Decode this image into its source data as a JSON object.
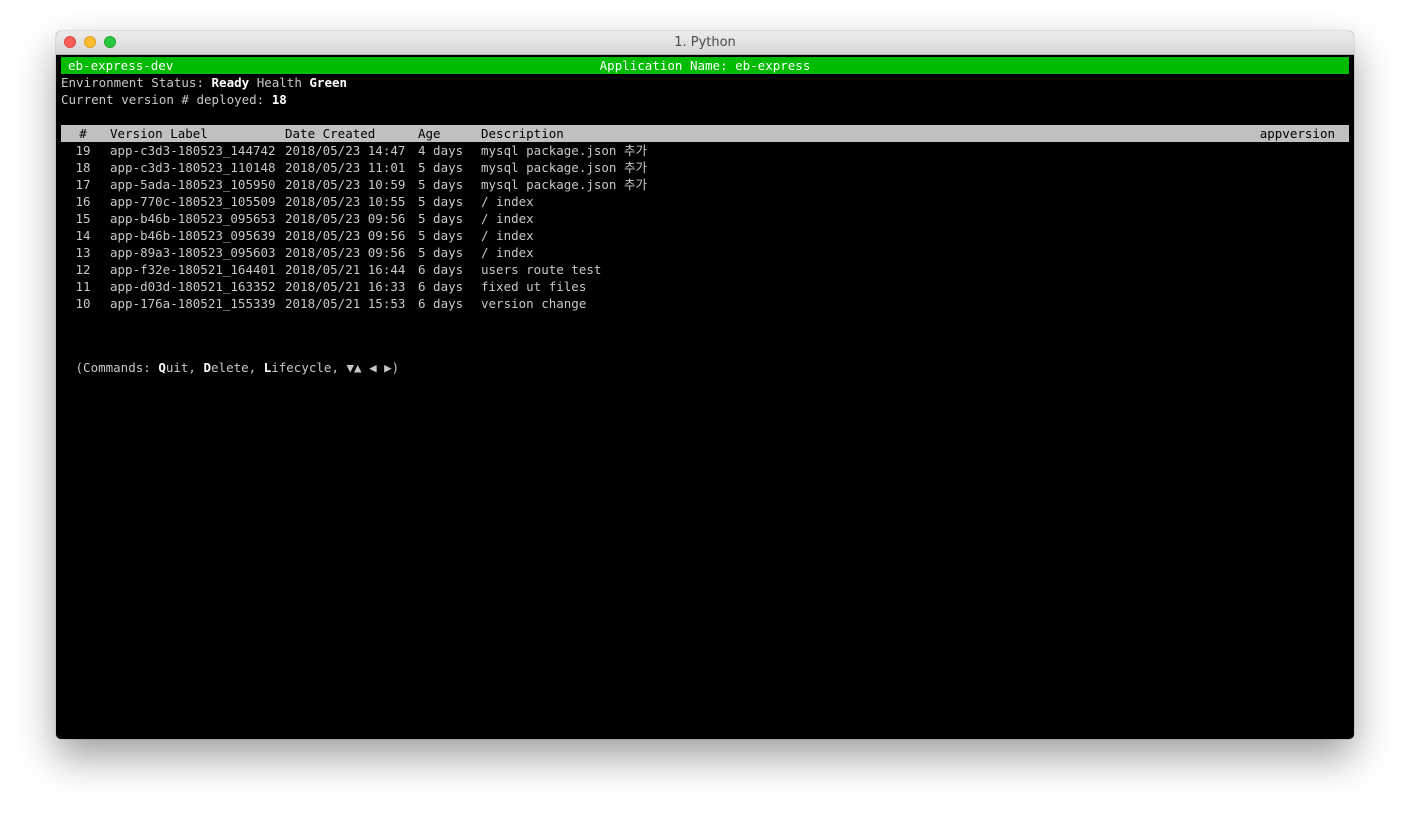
{
  "window": {
    "title": "1. Python"
  },
  "status_bar": {
    "environment": "eb-express-dev",
    "application": "Application Name: eb-express"
  },
  "info": {
    "env_status_label": "Environment Status:",
    "env_status_value": "Ready",
    "health_label": "Health",
    "health_value": "Green",
    "current_version_label": "Current version # deployed:",
    "current_version_value": "18"
  },
  "table": {
    "columns": {
      "num": "#",
      "label": "Version Label",
      "date": "Date Created",
      "age": "Age",
      "description": "Description",
      "appversion": "appversion"
    },
    "rows": [
      {
        "num": "19",
        "label": "app-c3d3-180523_144742",
        "date": "2018/05/23 14:47",
        "age": "4 days",
        "description": "mysql package.json 추가"
      },
      {
        "num": "18",
        "label": "app-c3d3-180523_110148",
        "date": "2018/05/23 11:01",
        "age": "5 days",
        "description": "mysql package.json 추가"
      },
      {
        "num": "17",
        "label": "app-5ada-180523_105950",
        "date": "2018/05/23 10:59",
        "age": "5 days",
        "description": "mysql package.json 추가"
      },
      {
        "num": "16",
        "label": "app-770c-180523_105509",
        "date": "2018/05/23 10:55",
        "age": "5 days",
        "description": "/ index"
      },
      {
        "num": "15",
        "label": "app-b46b-180523_095653",
        "date": "2018/05/23 09:56",
        "age": "5 days",
        "description": "/ index"
      },
      {
        "num": "14",
        "label": "app-b46b-180523_095639",
        "date": "2018/05/23 09:56",
        "age": "5 days",
        "description": "/ index"
      },
      {
        "num": "13",
        "label": "app-89a3-180523_095603",
        "date": "2018/05/23 09:56",
        "age": "5 days",
        "description": "/ index"
      },
      {
        "num": "12",
        "label": "app-f32e-180521_164401",
        "date": "2018/05/21 16:44",
        "age": "6 days",
        "description": "users route test"
      },
      {
        "num": "11",
        "label": "app-d03d-180521_163352",
        "date": "2018/05/21 16:33",
        "age": "6 days",
        "description": "fixed ut files"
      },
      {
        "num": "10",
        "label": "app-176a-180521_155339",
        "date": "2018/05/21 15:53",
        "age": "6 days",
        "description": "version change"
      }
    ]
  },
  "commands": {
    "open": " (Commands: ",
    "quit_key": "Q",
    "quit_rest": "uit, ",
    "delete_key": "D",
    "delete_rest": "elete, ",
    "lifecycle_key": "L",
    "lifecycle_rest": "ifecycle, ",
    "arrows": "▼▲ ◀ ▶",
    "close": ")"
  },
  "colors": {
    "status_bar_bg": "#00bb00",
    "header_bg": "#c0c0c0",
    "terminal_bg": "#000000"
  }
}
